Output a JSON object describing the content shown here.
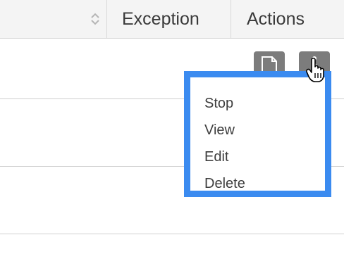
{
  "table": {
    "headers": {
      "exception": "Exception",
      "actions": "Actions"
    }
  },
  "actions_menu": {
    "items": [
      {
        "label": "Stop"
      },
      {
        "label": "View"
      },
      {
        "label": "Edit"
      },
      {
        "label": "Delete"
      }
    ]
  },
  "colors": {
    "menu_highlight": "#3b8bf0",
    "action_button": "#7c7c7c"
  }
}
